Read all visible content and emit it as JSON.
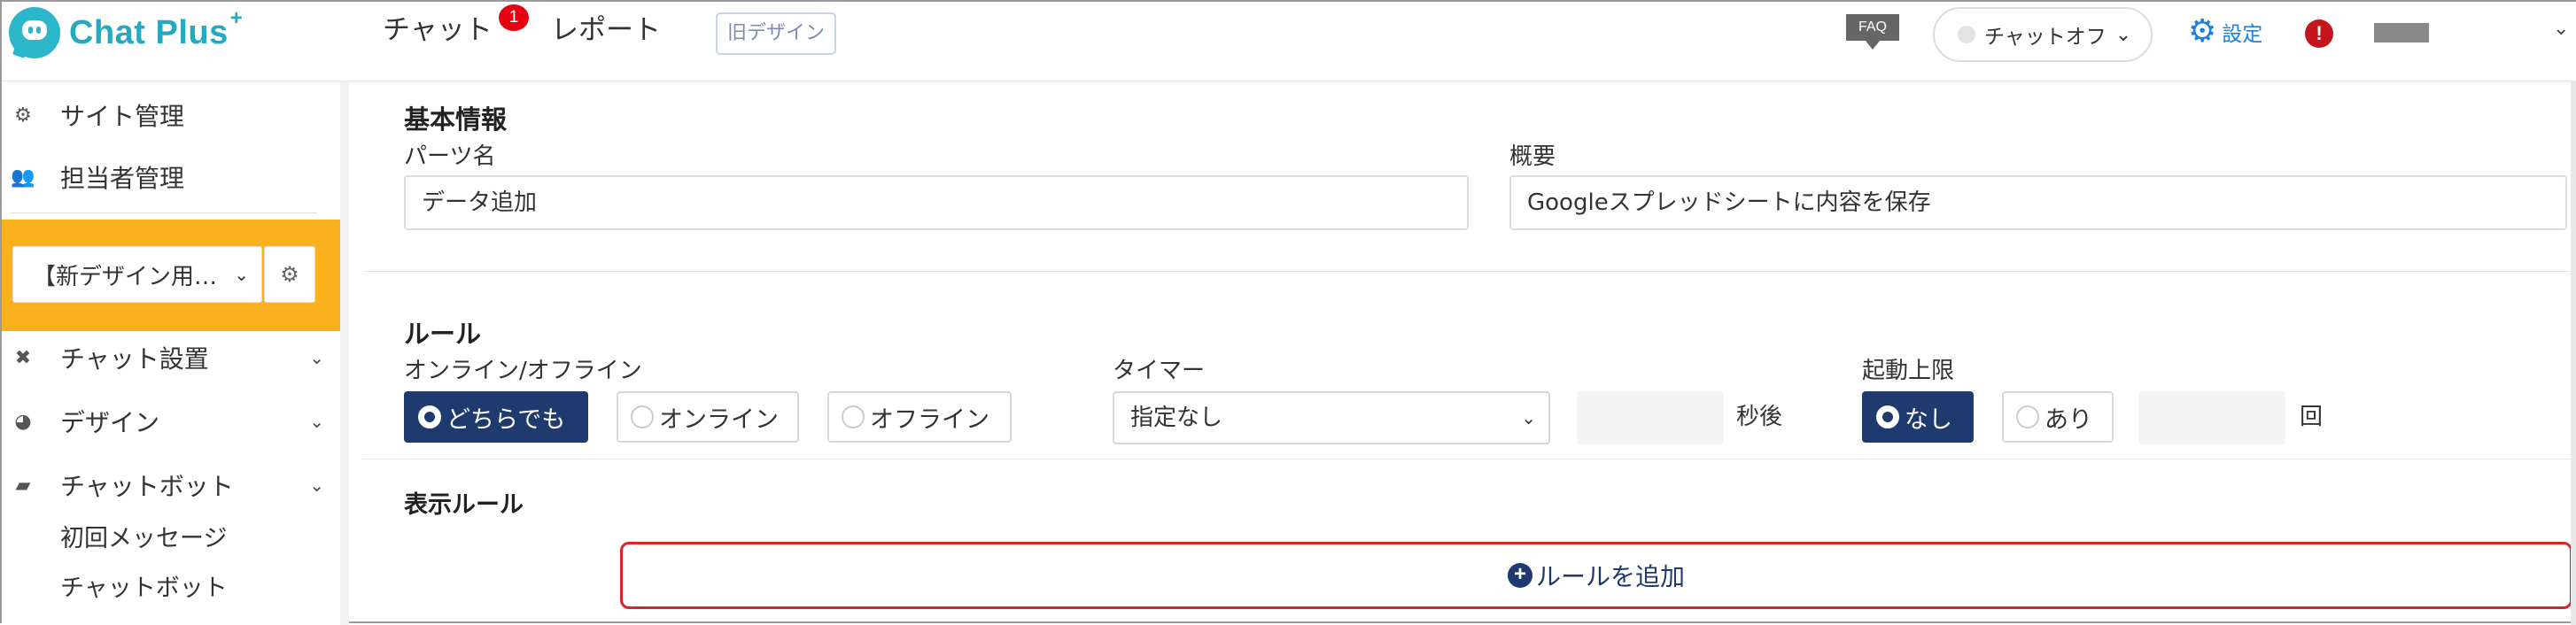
{
  "header": {
    "logo_text": "Chat Plus",
    "logo_plus": "+",
    "nav_chat": "チャット",
    "nav_chat_badge": "1",
    "nav_report": "レポート",
    "old_design": "旧デザイン",
    "faq": "FAQ",
    "chat_status": "チャットオフ",
    "settings": "設定",
    "alert": "!"
  },
  "sidebar": {
    "site_admin": "サイト管理",
    "staff_admin": "担当者管理",
    "site_select": "【新デザイン用…",
    "chat_setup": "チャット設置",
    "design": "デザイン",
    "chatbot": "チャットボット",
    "first_message": "初回メッセージ",
    "chatbot_sub": "チャットボット"
  },
  "basic_info": {
    "title": "基本情報",
    "part_name_label": "パーツ名",
    "part_name_value": "データ追加",
    "summary_label": "概要",
    "summary_value": "Googleスプレッドシートに内容を保存"
  },
  "rule": {
    "title": "ルール",
    "online_label": "オンライン/オフライン",
    "opt_either": "どちらでも",
    "opt_online": "オンライン",
    "opt_offline": "オフライン",
    "timer_label": "タイマー",
    "timer_value": "指定なし",
    "timer_unit": "秒後",
    "limit_label": "起動上限",
    "limit_none": "なし",
    "limit_yes": "あり",
    "limit_unit": "回"
  },
  "display_rule": {
    "title": "表示ルール",
    "add_button": "ルールを追加"
  },
  "colors": {
    "brand": "#25a9c0",
    "selected": "#1e3a6e",
    "highlight": "#fbb11d",
    "outline_red": "#e0202a"
  }
}
